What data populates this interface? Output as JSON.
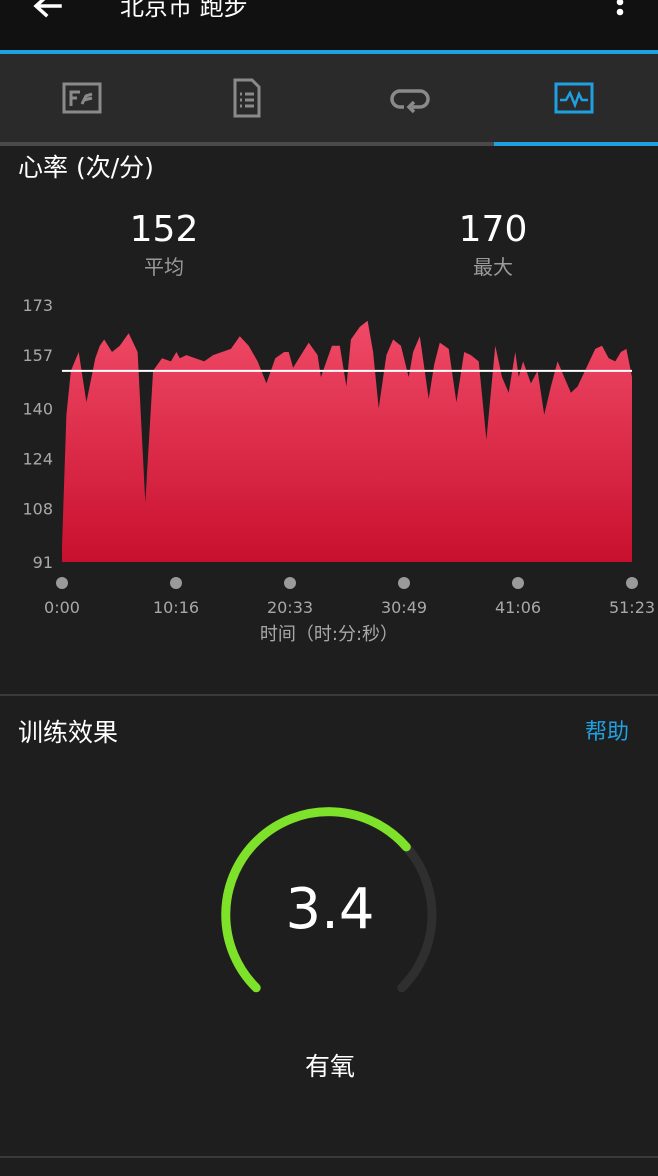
{
  "header": {
    "title": "北京市 跑步"
  },
  "tabs": [
    {
      "icon": "map-overview-icon",
      "active": false
    },
    {
      "icon": "details-list-icon",
      "active": false
    },
    {
      "icon": "laps-loop-icon",
      "active": false
    },
    {
      "icon": "heart-rate-chart-icon",
      "active": true
    }
  ],
  "heart_rate": {
    "section_title": "心率 (次/分)",
    "avg_value": "152",
    "avg_label": "平均",
    "max_value": "170",
    "max_label": "最大",
    "axis_title": "时间（时:分:秒）"
  },
  "chart_data": {
    "type": "area",
    "ylim": [
      91,
      173
    ],
    "yticks": [
      "173",
      "157",
      "140",
      "124",
      "108",
      "91"
    ],
    "xticks": [
      "0:00",
      "10:16",
      "20:33",
      "30:49",
      "41:06",
      "51:23"
    ],
    "average_line": 152,
    "series": [
      {
        "x_minutes": [
          0,
          0.4,
          0.8,
          1.5,
          2.2,
          3.0,
          3.4,
          3.8,
          4.5,
          5.2,
          6.0,
          6.8,
          7.5,
          8.2,
          9.0,
          9.8,
          10.3,
          10.6,
          11.2,
          12.0,
          12.8,
          13.6,
          14.4,
          15.2,
          16.0,
          16.8,
          17.6,
          18.4,
          19.2,
          20.0,
          20.4,
          20.8,
          21.5,
          22.2,
          23.0,
          23.3,
          23.7,
          24.3,
          25.0,
          25.6,
          26.0,
          26.8,
          27.5,
          28.0,
          28.5,
          29.2,
          29.8,
          30.5,
          31.2,
          31.6,
          32.2,
          33.0,
          33.5,
          34.0,
          34.8,
          35.5,
          36.2,
          36.8,
          37.5,
          38.2,
          39.0,
          39.6,
          40.2,
          40.8,
          41.1,
          41.5,
          42.2,
          42.8,
          43.4,
          44.0,
          44.6,
          45.2,
          45.8,
          46.4,
          47.2,
          48.0,
          48.6,
          49.2,
          49.8,
          50.3,
          50.8,
          51.3
        ],
        "bpm": [
          96,
          138,
          152,
          158,
          142,
          156,
          160,
          162,
          158,
          160,
          164,
          158,
          110,
          152,
          156,
          155,
          158,
          156,
          157,
          156,
          155,
          157,
          158,
          159,
          163,
          160,
          155,
          148,
          156,
          158,
          158,
          153,
          157,
          161,
          157,
          150,
          154,
          160,
          160,
          147,
          162,
          166,
          168,
          158,
          140,
          157,
          162,
          160,
          150,
          158,
          163,
          143,
          154,
          161,
          159,
          142,
          158,
          157,
          155,
          130,
          160,
          150,
          145,
          158,
          150,
          155,
          148,
          152,
          138,
          147,
          155,
          150,
          145,
          147,
          153,
          159,
          160,
          156,
          155,
          158,
          159,
          150
        ]
      }
    ]
  },
  "training_effect": {
    "section_title": "训练效果",
    "help_label": "帮助",
    "value": "3.4",
    "value_number": 3.4,
    "scale_max": 5.0,
    "label": "有氧",
    "accent_color": "#7ee22b",
    "track_color": "#2f2f2f"
  },
  "colors": {
    "accent": "#1fa0e0",
    "chart_fill_top": "#f04a67",
    "chart_fill_bottom": "#c8102e"
  }
}
